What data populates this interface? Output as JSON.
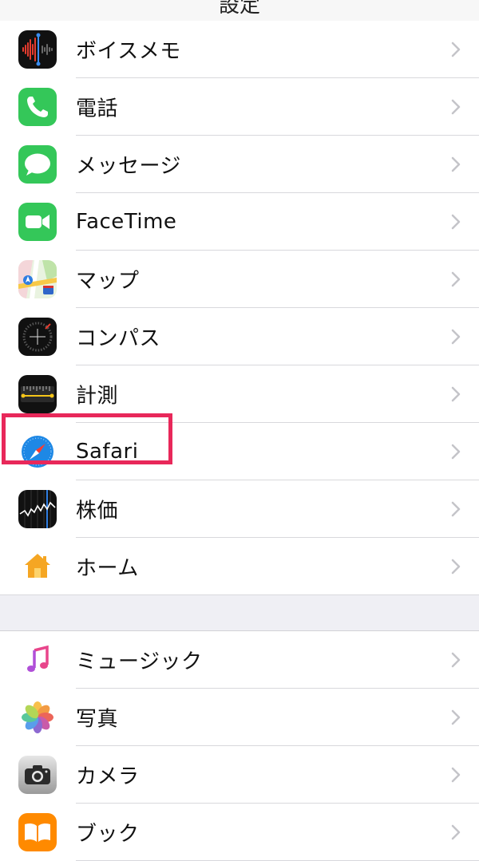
{
  "nav": {
    "title": "設定"
  },
  "group1": [
    {
      "key": "voice-memos",
      "label": "ボイスメモ"
    },
    {
      "key": "phone",
      "label": "電話"
    },
    {
      "key": "messages",
      "label": "メッセージ"
    },
    {
      "key": "facetime",
      "label": "FaceTime"
    },
    {
      "key": "maps",
      "label": "マップ"
    },
    {
      "key": "compass",
      "label": "コンパス"
    },
    {
      "key": "measure",
      "label": "計測"
    },
    {
      "key": "safari",
      "label": "Safari"
    },
    {
      "key": "stocks",
      "label": "株価"
    },
    {
      "key": "home",
      "label": "ホーム"
    }
  ],
  "group2": [
    {
      "key": "music",
      "label": "ミュージック"
    },
    {
      "key": "photos",
      "label": "写真"
    },
    {
      "key": "camera",
      "label": "カメラ"
    },
    {
      "key": "books",
      "label": "ブック"
    }
  ],
  "icons": {
    "voice-memos": "waveform-icon",
    "phone": "phone-handset-icon",
    "messages": "speech-bubble-icon",
    "facetime": "video-camera-icon",
    "maps": "map-icon",
    "compass": "compass-icon",
    "measure": "ruler-icon",
    "safari": "safari-compass-icon",
    "stocks": "stock-chart-icon",
    "home": "house-icon",
    "music": "music-note-icon",
    "photos": "photos-flower-icon",
    "camera": "camera-icon",
    "books": "open-book-icon"
  },
  "colors": {
    "highlight": "#e8285a",
    "phone_green": "#34c759",
    "safari_blue": "#1e88e5",
    "home_orange": "#f5a623",
    "books_orange": "#ff8a00"
  }
}
